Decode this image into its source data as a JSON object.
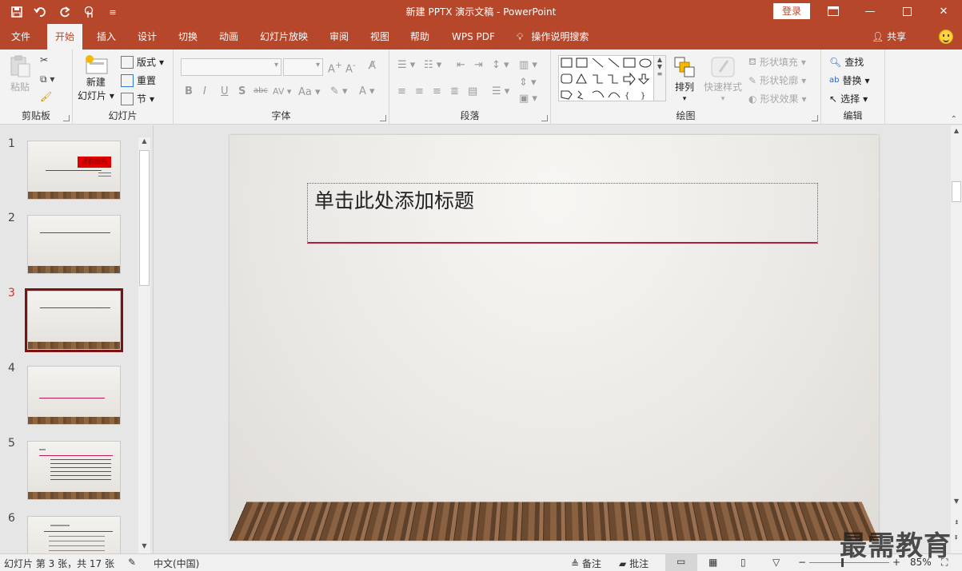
{
  "app": {
    "title": "新建 PPTX 演示文稿 - PowerPoint",
    "login_label": "登录",
    "share_label": "共享",
    "accent_color": "#b7472a"
  },
  "qat": {
    "icons": [
      "save-icon",
      "undo-icon",
      "redo-icon",
      "touch-mode-icon",
      "customize-icon"
    ]
  },
  "window_controls": {
    "icons": [
      "ribbon-display-icon",
      "minimize-icon",
      "maximize-icon",
      "close-icon"
    ]
  },
  "tabs": [
    "文件",
    "开始",
    "插入",
    "设计",
    "切换",
    "动画",
    "幻灯片放映",
    "审阅",
    "视图",
    "帮助",
    "WPS PDF",
    "操作说明搜索"
  ],
  "active_tab": "开始",
  "ribbon": {
    "clipboard": {
      "paste": "粘贴",
      "label": "剪贴板"
    },
    "slides": {
      "new_slide_1": "新建",
      "new_slide_2": "幻灯片",
      "layout": "版式",
      "reset": "重置",
      "section": "节",
      "label": "幻灯片"
    },
    "font": {
      "bold": "B",
      "italic": "I",
      "underline": "U",
      "shadow": "S",
      "strike": "abc",
      "case": "Aa",
      "label": "字体"
    },
    "paragraph": {
      "label": "段落"
    },
    "drawing": {
      "arrange": "排列",
      "quick_styles": "快速样式",
      "shape_fill": "形状填充",
      "shape_outline": "形状轮廓",
      "shape_effects": "形状效果",
      "label": "绘图"
    },
    "editing": {
      "find": "查找",
      "replace": "替换",
      "select": "选择",
      "label": "编辑"
    }
  },
  "thumbnails": {
    "numbers": [
      "1",
      "2",
      "3",
      "4",
      "5",
      "6"
    ],
    "selected": 3,
    "slide1_title": "述职报告"
  },
  "slide": {
    "title_placeholder": "单击此处添加标题"
  },
  "status": {
    "slide_info": "幻灯片 第 3 张，共 17 张",
    "language": "中文(中国)",
    "notes": "备注",
    "comments": "批注",
    "zoom": "85%",
    "zoom_fraction": 0.5
  },
  "watermark": "最需教育"
}
